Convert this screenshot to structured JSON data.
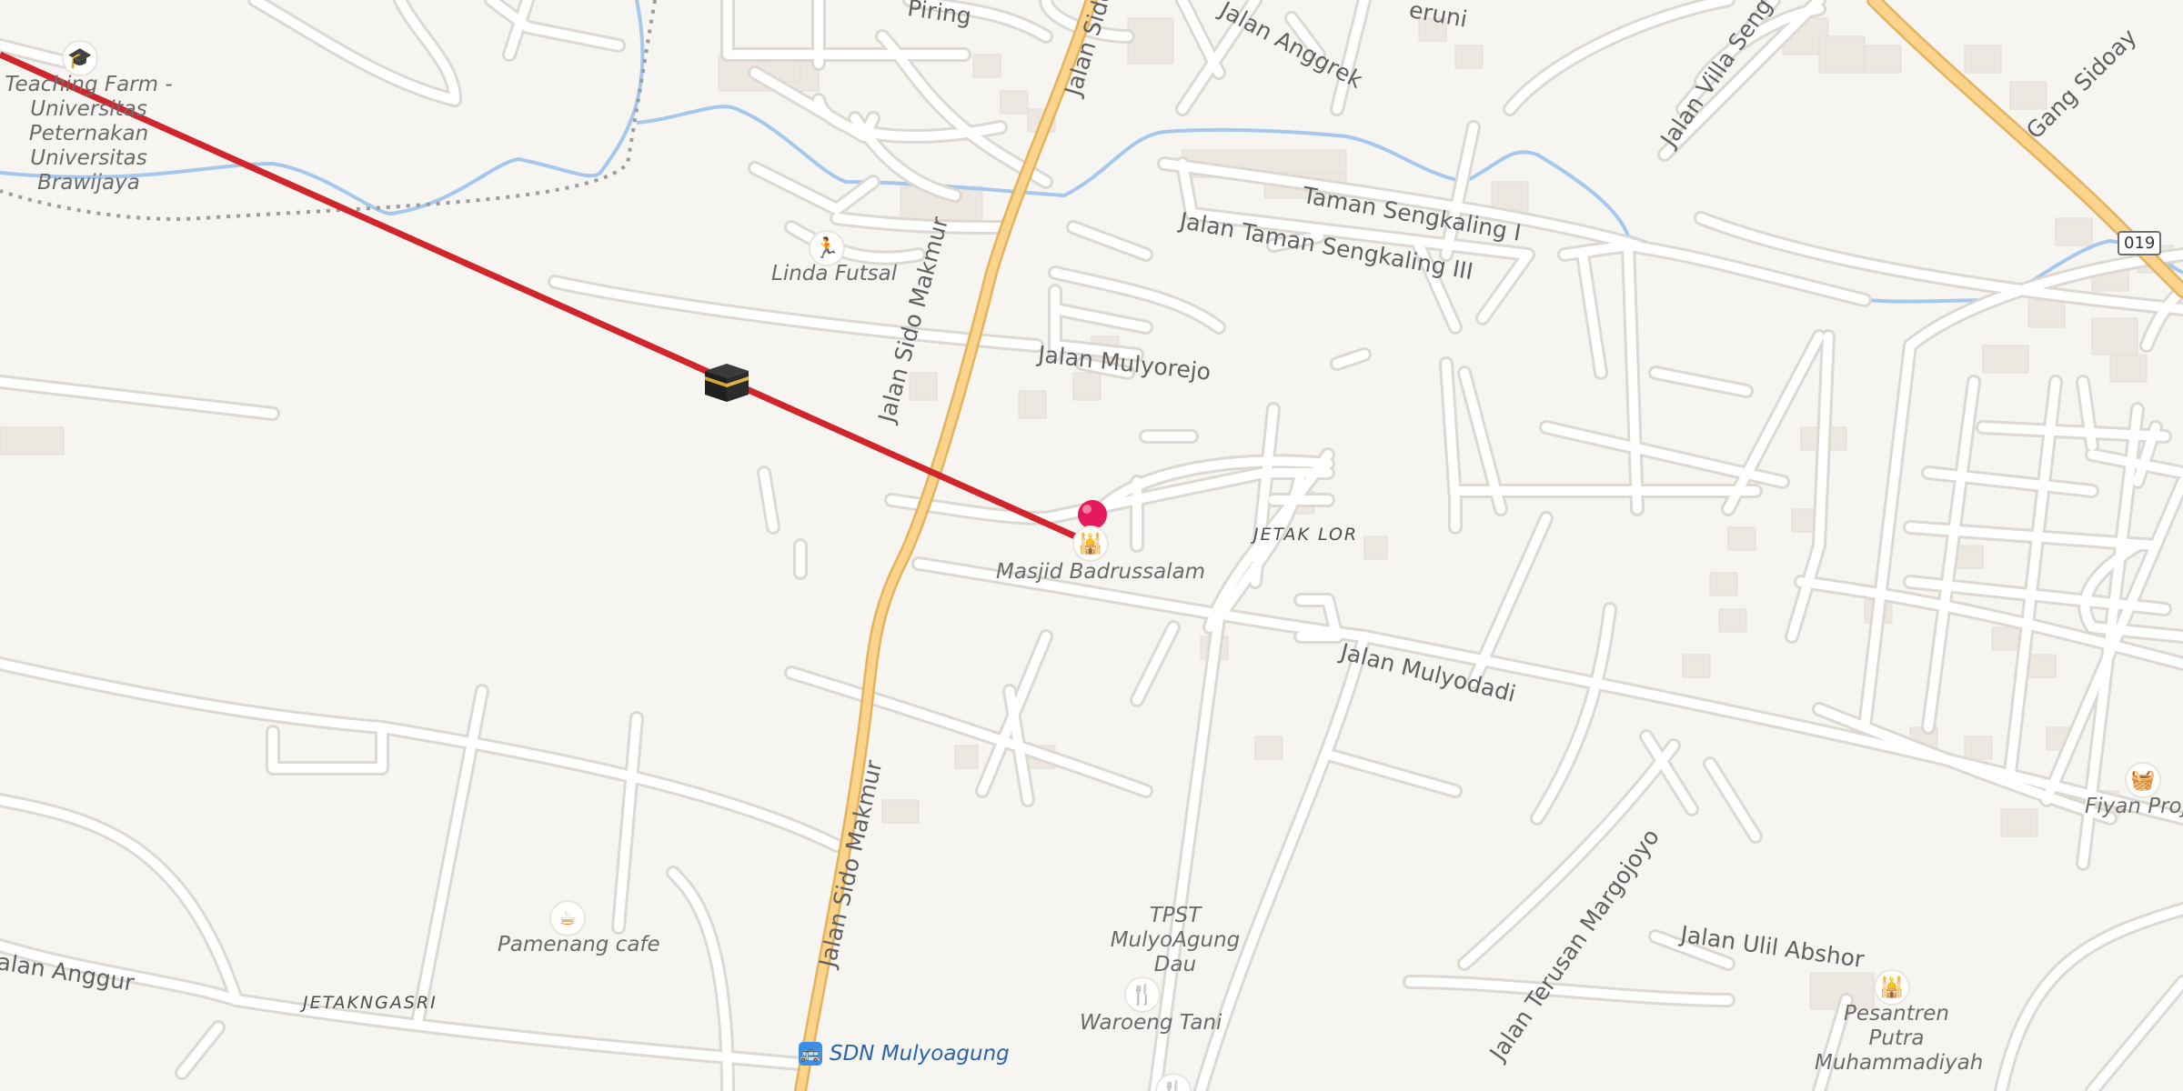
{
  "map": {
    "street_labels": [
      "Jalan Sido Makmur",
      "Jalan Sido Makmur",
      "Jalan Sido",
      "Jalan Anggrek",
      "Taman Sengkaling I",
      "Jalan Taman Sengkaling III",
      "Jalan Mulyorejo",
      "Jalan Mulyodadi",
      "Jalan Villa Seng",
      "Gang Sidoay",
      "Jalan Terusan Margojoyo",
      "Jalan Ulil Abshor",
      "Jalan Anggur",
      "Piring",
      "eruni"
    ],
    "area_labels": [
      "JETAK LOR",
      "JETAKNGASRI"
    ],
    "pois": [
      {
        "name": "Teaching Farm - Universitas Peternakan Universitas Brawijaya",
        "icon": "graduation-cap-icon"
      },
      {
        "name": "Linda Futsal",
        "icon": "running-person-icon"
      },
      {
        "name": "Masjid Badrussalam",
        "icon": "mosque-icon"
      },
      {
        "name": "Pamenang cafe",
        "icon": "coffee-cup-icon"
      },
      {
        "name": "TPST MulyoAgung Dau",
        "icon": ""
      },
      {
        "name": "Waroeng Tani",
        "icon": "fork-knife-icon"
      },
      {
        "name": "SDN Mulyoagung",
        "icon": "bus-icon"
      },
      {
        "name": "Pesantren Putra Muhammadiyah",
        "icon": "mosque-icon"
      },
      {
        "name": "Fiyan Proje",
        "icon": "shopping-basket-icon"
      }
    ],
    "route_shield": "019",
    "qibla_icon": "kaaba-icon",
    "location_pin": "red-location-pin-icon",
    "colors": {
      "background": "#f7f5f2",
      "road": "#ffffff",
      "road_casing": "#dcd8d2",
      "main_road": "#fbd38a",
      "main_road_casing": "#e3b35e",
      "river": "#a5c8ec",
      "building": "#ece7e1",
      "qibla_line": "#d0262b",
      "pin": "#e6195d"
    }
  }
}
